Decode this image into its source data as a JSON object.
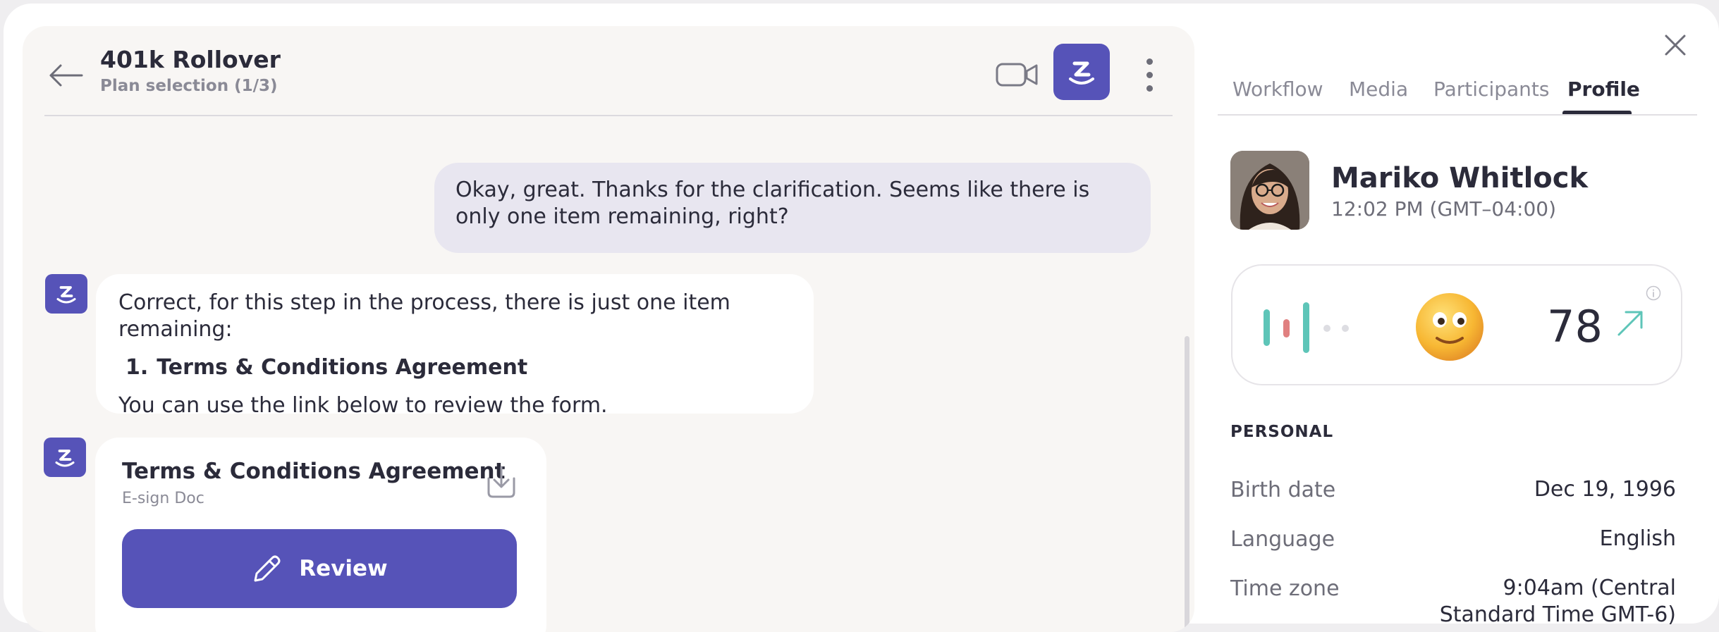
{
  "chat": {
    "title": "401k Rollover",
    "subtitle": "Plan selection (1/3)",
    "messages": {
      "user_message": "Okay, great. Thanks for the clarification. Seems like there is only one item remaining, right?",
      "bot_intro": "Correct, for this step in the process, there is just one item remaining:",
      "bot_list": [
        {
          "number": "1.",
          "text": "Terms & Conditions Agreement"
        }
      ],
      "bot_outro": "You can use the link below to review the form."
    },
    "document": {
      "title": "Terms & Conditions Agreement",
      "type": "E-sign Doc",
      "review_label": "Review"
    }
  },
  "panel": {
    "tabs": [
      {
        "label": "Workflow",
        "active": false
      },
      {
        "label": "Media",
        "active": false
      },
      {
        "label": "Participants",
        "active": false
      },
      {
        "label": "Profile",
        "active": true
      }
    ],
    "profile": {
      "name": "Mariko Whitlock",
      "local_time": "12:02 PM (GMT–04:00)"
    },
    "sentiment": {
      "score": "78",
      "trend": "up",
      "emoji": "slightly-smiling-face"
    },
    "personal": {
      "section_label": "PERSONAL",
      "rows": [
        {
          "label": "Birth date",
          "value": "Dec 19, 1996"
        },
        {
          "label": "Language",
          "value": "English"
        },
        {
          "label": "Time zone",
          "value": "9:04am (Central Standard Time GMT-6)"
        }
      ]
    }
  },
  "colors": {
    "brand": "#5653b8",
    "accent_red": "#e08080",
    "accent_teal": "#5ec5b8",
    "user_bubble": "#e8e6f0"
  }
}
